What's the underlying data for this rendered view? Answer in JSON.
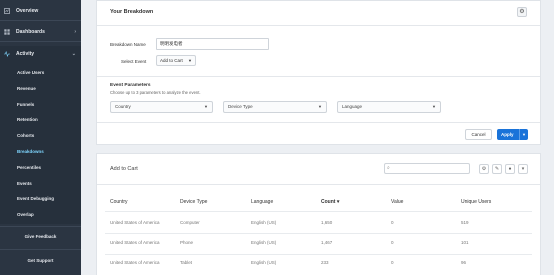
{
  "sidebar": {
    "top_items": [
      {
        "label": "Overview",
        "icon": "overview-icon"
      },
      {
        "label": "Dashboards",
        "icon": "dashboards-icon"
      }
    ],
    "activity": {
      "label": "Activity",
      "icon": "activity-icon"
    },
    "sub_items": [
      "Active Users",
      "Revenue",
      "Funnels",
      "Retention",
      "Cohorts",
      "Breakdowns",
      "Percentiles",
      "Events",
      "Event Debugging",
      "Overlap"
    ],
    "active_item": "Breakdowns",
    "give_feedback": "Give Feedback",
    "get_support": "Get Support"
  },
  "breakdown": {
    "title": "Your Breakdown",
    "name_label": "Breakdown Name",
    "name_value": "明明发电者",
    "event_label": "Select Event",
    "event_value": "Add to Cart",
    "params_title": "Event Parameters",
    "params_sub": "Choose up to 3 parameters to analyze the event.",
    "params": [
      "Country",
      "Device Type",
      "Language"
    ],
    "cancel": "Cancel",
    "apply": "Apply"
  },
  "results": {
    "title": "Add to Cart",
    "columns": [
      "Country",
      "Device Type",
      "Language",
      "Count ▾",
      "Value",
      "Unique Users"
    ],
    "rows": [
      [
        "United States of America",
        "Computer",
        "English (US)",
        "1,650",
        "0",
        "519"
      ],
      [
        "United States of America",
        "Phone",
        "English (US)",
        "1,467",
        "0",
        "101"
      ],
      [
        "United States of America",
        "Tablet",
        "English (US)",
        "233",
        "0",
        "96"
      ]
    ]
  },
  "colors": {
    "sidebar": "#2b3542",
    "accent": "#1a73d9",
    "active": "#7fd6ff"
  }
}
